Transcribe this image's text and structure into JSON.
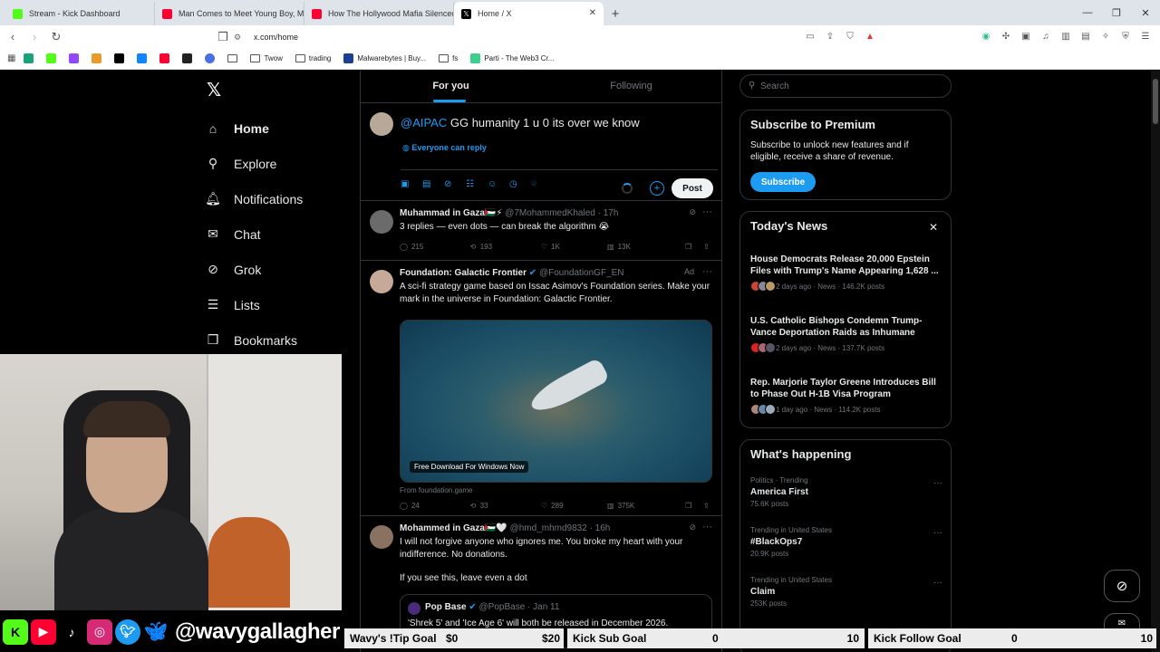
{
  "browser": {
    "tabs": [
      {
        "label": "Stream - Kick Dashboard",
        "color": "#53fc18"
      },
      {
        "label": "Man Comes to Meet Young Boy, Me",
        "color": "#ff0033"
      },
      {
        "label": "How The Hollywood Mafia Silenced",
        "color": "#ff0033"
      },
      {
        "label": "Home / X",
        "color": "#000000"
      }
    ],
    "new_tab": "+",
    "url": "x.com/home",
    "bookmarks": [
      "Twow",
      "trading",
      "Malwarebytes | Buy...",
      "fs",
      "Parti - The Web3 Cr..."
    ]
  },
  "x": {
    "nav": [
      {
        "label": "Home",
        "icon": "home-icon",
        "glyph": "⌂"
      },
      {
        "label": "Explore",
        "icon": "search-icon",
        "glyph": "⚲"
      },
      {
        "label": "Notifications",
        "icon": "bell-icon",
        "glyph": "🔔︎"
      },
      {
        "label": "Chat",
        "icon": "mail-icon",
        "glyph": "✉"
      },
      {
        "label": "Grok",
        "icon": "grok-icon",
        "glyph": "⊘"
      },
      {
        "label": "Lists",
        "icon": "list-icon",
        "glyph": "☰"
      },
      {
        "label": "Bookmarks",
        "icon": "bookmark-icon",
        "glyph": "❒"
      }
    ],
    "feed_tabs": {
      "for_you": "For you",
      "following": "Following"
    },
    "compose": {
      "mention": "@AIPAC",
      "text": " GG humanity 1 u 0 its over we know",
      "reply_setting": "Everyone can reply",
      "post_label": "Post"
    },
    "tweets": [
      {
        "name": "Muhammad in Gaza🇵🇸⚡",
        "handle": "@7MohammedKhaled · 17h",
        "body": "3 replies — even dots — can break the algorithm 😭",
        "replies": "215",
        "reposts": "193",
        "likes": "1K",
        "views": "13K"
      },
      {
        "name": "Foundation: Galactic Frontier",
        "handle": "@FoundationGF_EN",
        "ad": "Ad",
        "body": "A sci-fi strategy game based on Issac Asimov's Foundation series. Make your mark in the universe in Foundation: Galactic Frontier.",
        "media_caption": "Free Download For Windows Now",
        "from": "From foundation.game",
        "replies": "24",
        "reposts": "33",
        "likes": "289",
        "views": "375K"
      },
      {
        "name": "Mohammed in Gaza🇵🇸🤍",
        "handle": "@hmd_mhmd9832 · 16h",
        "body": "I will not forgive anyone who ignores me. You broke my heart with your indifference. No donations.",
        "body2": "If you see this, leave even a dot",
        "quote_name": "Pop Base",
        "quote_handle": "@PopBase · Jan 11",
        "quote_body": "'Shrek 5' and 'Ice Age 6' will both be released in December 2026."
      }
    ],
    "search_placeholder": "Search",
    "premium": {
      "title": "Subscribe to Premium",
      "desc": "Subscribe to unlock new features and if eligible, receive a share of revenue.",
      "button": "Subscribe"
    },
    "news": {
      "title": "Today's News",
      "items": [
        {
          "headline": "House Democrats Release 20,000 Epstein Files with Trump's Name Appearing 1,628 ...",
          "meta": "2 days ago · News · 146.2K posts"
        },
        {
          "headline": "U.S. Catholic Bishops Condemn Trump-Vance Deportation Raids as Inhumane",
          "meta": "2 days ago · News · 137.7K posts"
        },
        {
          "headline": "Rep. Marjorie Taylor Greene Introduces Bill to Phase Out H-1B Visa Program",
          "meta": "1 day ago · News · 114.2K posts"
        }
      ]
    },
    "happening": {
      "title": "What's happening",
      "items": [
        {
          "context": "Politics · Trending",
          "topic": "America First",
          "posts": "75.6K posts"
        },
        {
          "context": "Trending in United States",
          "topic": "#BlackOps7",
          "posts": "20.9K posts"
        },
        {
          "context": "Trending in United States",
          "topic": "Claim",
          "posts": "253K posts"
        }
      ]
    }
  },
  "overlay": {
    "handle": "@wavygallagher",
    "goals": [
      {
        "label": "Wavy's !Tip Goal",
        "current": "$0",
        "target": "$20"
      },
      {
        "label": "Kick Sub Goal",
        "current": "0",
        "target": "10"
      },
      {
        "label": "Kick Follow Goal",
        "current": "0",
        "target": "10"
      }
    ]
  }
}
